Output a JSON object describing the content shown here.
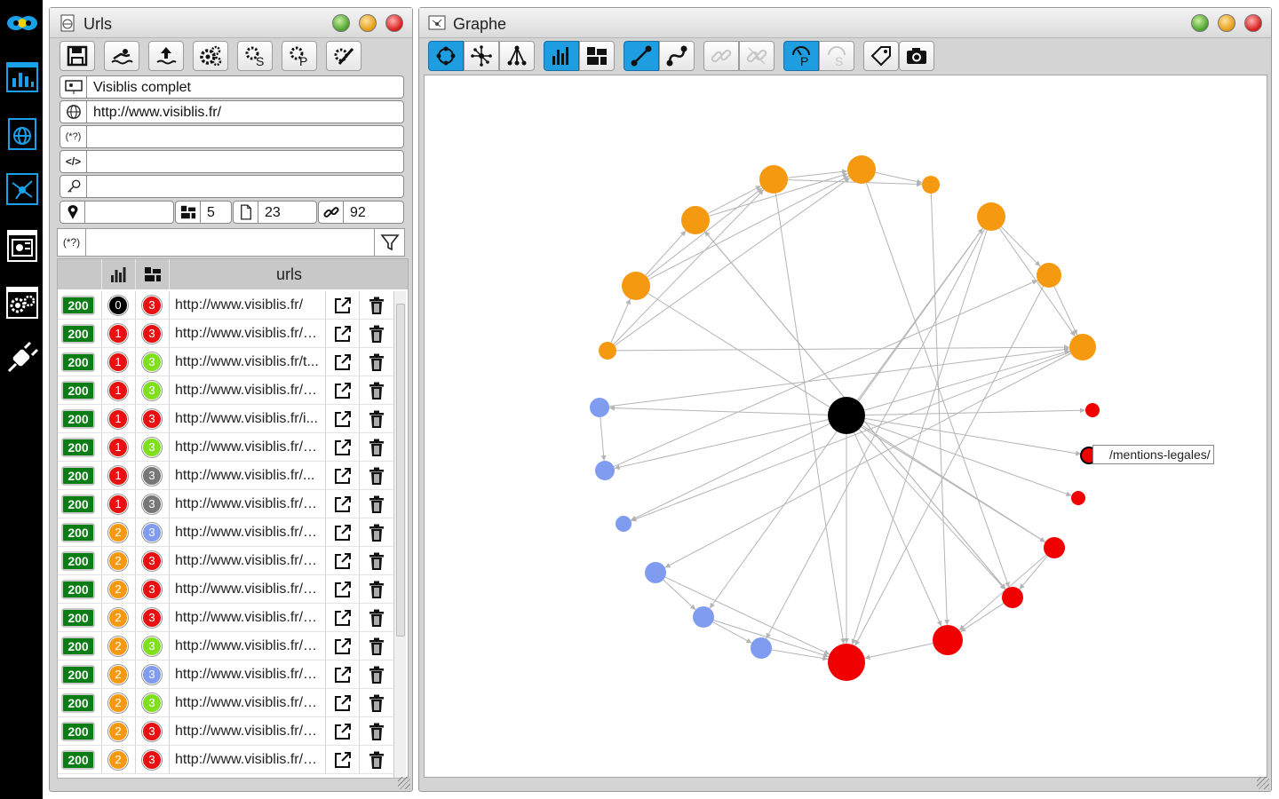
{
  "sidebar": {
    "items": [
      "logo-icon",
      "dashboard-icon",
      "urls-icon",
      "graph-icon",
      "report-icon",
      "settings-icon",
      "disconnect-icon"
    ]
  },
  "urls_window": {
    "title": "Urls",
    "project_name": "Visiblis complet",
    "site_url": "http://www.visiblis.fr/",
    "regex_label": "(*?)",
    "code_label": "</>",
    "stats": {
      "location": "",
      "depth": "5",
      "pages": "23",
      "links": "92"
    },
    "filter": {
      "prefix": "(*?)",
      "value": ""
    },
    "columns": [
      "",
      "",
      "",
      "urls"
    ],
    "rows": [
      {
        "status": "200",
        "depth": "0",
        "depth_color": "#000000",
        "links": "3",
        "links_color": "#e81010",
        "url": "http://www.visiblis.fr/"
      },
      {
        "status": "200",
        "depth": "1",
        "depth_color": "#e81010",
        "links": "3",
        "links_color": "#e81010",
        "url": "http://www.visiblis.fr/p..."
      },
      {
        "status": "200",
        "depth": "1",
        "depth_color": "#e81010",
        "links": "3",
        "links_color": "#7fe020",
        "url": "http://www.visiblis.fr/t..."
      },
      {
        "status": "200",
        "depth": "1",
        "depth_color": "#e81010",
        "links": "3",
        "links_color": "#7fe020",
        "url": "http://www.visiblis.fr/a..."
      },
      {
        "status": "200",
        "depth": "1",
        "depth_color": "#e81010",
        "links": "3",
        "links_color": "#e81010",
        "url": "http://www.visiblis.fr/i..."
      },
      {
        "status": "200",
        "depth": "1",
        "depth_color": "#e81010",
        "links": "3",
        "links_color": "#7fe020",
        "url": "http://www.visiblis.fr/c..."
      },
      {
        "status": "200",
        "depth": "1",
        "depth_color": "#e81010",
        "links": "3",
        "links_color": "#777777",
        "url": "http://www.visiblis.fr/..."
      },
      {
        "status": "200",
        "depth": "1",
        "depth_color": "#e81010",
        "links": "3",
        "links_color": "#777777",
        "url": "http://www.visiblis.fr/c..."
      },
      {
        "status": "200",
        "depth": "2",
        "depth_color": "#f59a10",
        "links": "3",
        "links_color": "#7f9cf0",
        "url": "http://www.visiblis.fr/p..."
      },
      {
        "status": "200",
        "depth": "2",
        "depth_color": "#f59a10",
        "links": "3",
        "links_color": "#e81010",
        "url": "http://www.visiblis.fr/p..."
      },
      {
        "status": "200",
        "depth": "2",
        "depth_color": "#f59a10",
        "links": "3",
        "links_color": "#e81010",
        "url": "http://www.visiblis.fr/p..."
      },
      {
        "status": "200",
        "depth": "2",
        "depth_color": "#f59a10",
        "links": "3",
        "links_color": "#e81010",
        "url": "http://www.visiblis.fr/a..."
      },
      {
        "status": "200",
        "depth": "2",
        "depth_color": "#f59a10",
        "links": "3",
        "links_color": "#7fe020",
        "url": "http://www.visiblis.fr/a..."
      },
      {
        "status": "200",
        "depth": "2",
        "depth_color": "#f59a10",
        "links": "3",
        "links_color": "#7f9cf0",
        "url": "http://www.visiblis.fr/a..."
      },
      {
        "status": "200",
        "depth": "2",
        "depth_color": "#f59a10",
        "links": "3",
        "links_color": "#7fe020",
        "url": "http://www.visiblis.fr/a..."
      },
      {
        "status": "200",
        "depth": "2",
        "depth_color": "#f59a10",
        "links": "3",
        "links_color": "#e81010",
        "url": "http://www.visiblis.fr/a..."
      },
      {
        "status": "200",
        "depth": "2",
        "depth_color": "#f59a10",
        "links": "3",
        "links_color": "#e81010",
        "url": "http://www.visiblis.fr/a..."
      }
    ]
  },
  "graph_window": {
    "title": "Graphe",
    "tooltip": "/mentions-legales/",
    "colors": {
      "root": "#000000",
      "depth1": "#f00000",
      "depth2": "#f59a10",
      "depth3": "#7f9cf0",
      "edge": "#b4b4b4"
    }
  }
}
